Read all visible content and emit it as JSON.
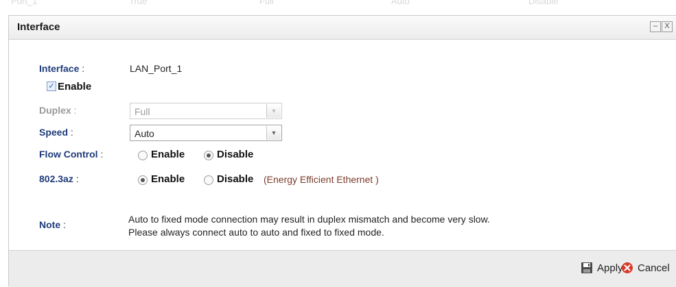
{
  "background": {
    "row_texts": [
      "Port_1",
      "True",
      "Full",
      "Auto",
      "Disable"
    ]
  },
  "dialog": {
    "title": "Interface",
    "minimize_glyph": "–",
    "close_glyph": "X"
  },
  "form": {
    "interface": {
      "label": "Interface",
      "colon": ":",
      "value": "LAN_Port_1"
    },
    "enable": {
      "label": "Enable",
      "checked": true
    },
    "duplex": {
      "label": "Duplex",
      "colon": ":",
      "selected": "Full",
      "disabled": true
    },
    "speed": {
      "label": "Speed",
      "colon": ":",
      "selected": "Auto"
    },
    "flow_control": {
      "label": "Flow Control",
      "colon": ":",
      "options": [
        "Enable",
        "Disable"
      ],
      "selected": "Disable"
    },
    "eee": {
      "label": "802.3az",
      "colon": ":",
      "options": [
        "Enable",
        "Disable"
      ],
      "selected": "Enable",
      "hint": "(Energy Efficient Ethernet )"
    },
    "note": {
      "label": "Note",
      "colon": ":",
      "line1": "Auto to fixed mode connection may result in duplex mismatch and become very slow.",
      "line2": "Please always connect auto to auto and fixed to fixed mode."
    }
  },
  "footer": {
    "apply_label": "Apply",
    "cancel_label": "Cancel",
    "apply_icon": "save-icon",
    "cancel_icon": "cancel-icon"
  },
  "colors": {
    "label_blue": "#1d3a7a",
    "hint_brown": "#7a3b2a",
    "cancel_red": "#d63a2a"
  }
}
